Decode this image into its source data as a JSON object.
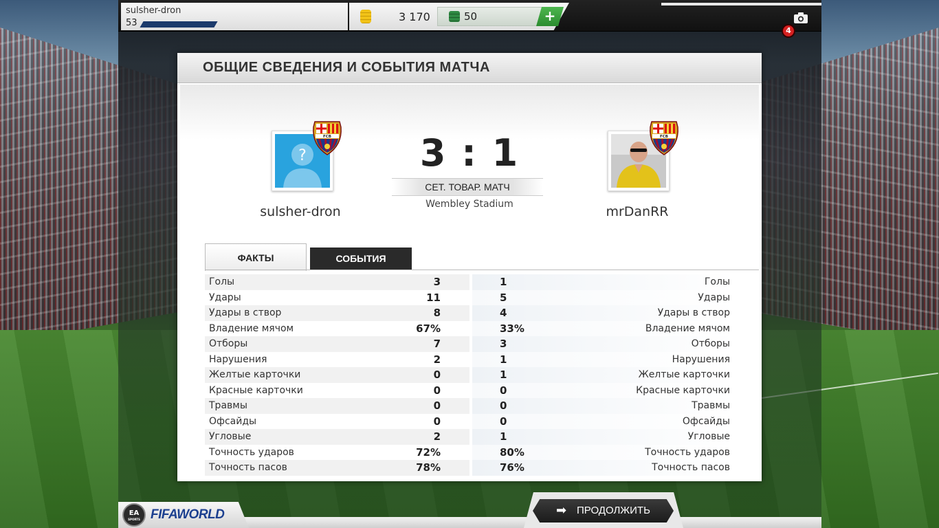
{
  "header": {
    "username": "sulsher-dron",
    "level": "53",
    "coins": "3 170",
    "points": "50",
    "add_points_label": "+",
    "notifications": "4"
  },
  "panel": {
    "title": "ОБЩИЕ СВЕДЕНИЯ И СОБЫТИЯ МАТЧА"
  },
  "match": {
    "home_player": "sulsher-dron",
    "away_player": "mrDanRR",
    "score": "3 : 1",
    "match_type": "СЕТ. ТОВАР. МАТЧ",
    "stadium": "Wembley Stadium"
  },
  "tabs": {
    "facts": "ФАКТЫ",
    "events": "СОБЫТИЯ"
  },
  "stats": [
    {
      "label": "Голы",
      "home": "3",
      "away": "1"
    },
    {
      "label": "Удары",
      "home": "11",
      "away": "5"
    },
    {
      "label": "Удары в створ",
      "home": "8",
      "away": "4"
    },
    {
      "label": "Владение мячом",
      "home": "67%",
      "away": "33%"
    },
    {
      "label": "Отборы",
      "home": "7",
      "away": "3"
    },
    {
      "label": "Нарушения",
      "home": "2",
      "away": "1"
    },
    {
      "label": "Желтые карточки",
      "home": "0",
      "away": "1"
    },
    {
      "label": "Красные карточки",
      "home": "0",
      "away": "0"
    },
    {
      "label": "Травмы",
      "home": "0",
      "away": "0"
    },
    {
      "label": "Офсайды",
      "home": "0",
      "away": "0"
    },
    {
      "label": "Угловые",
      "home": "2",
      "away": "1"
    },
    {
      "label": "Точность ударов",
      "home": "72%",
      "away": "80%"
    },
    {
      "label": "Точность пасов",
      "home": "78%",
      "away": "76%"
    }
  ],
  "footer": {
    "continue_label": "ПРОДОЛЖИТЬ",
    "brand_ea": "EA SPORTS",
    "brand_fifa": "FIFAWORLD"
  },
  "icons": {
    "coin": "coin-icon",
    "points": "fifa-points-icon",
    "camera": "camera-icon",
    "continue": "arrow-right-icon",
    "crest": "fcb-crest-icon",
    "avatar_placeholder": "silhouette-question-icon"
  },
  "colors": {
    "accent_green": "#2b8c2f",
    "xp_bar": "#1c3a6b",
    "notification": "#d62020",
    "avatar_placeholder_bg": "#29a3de"
  }
}
